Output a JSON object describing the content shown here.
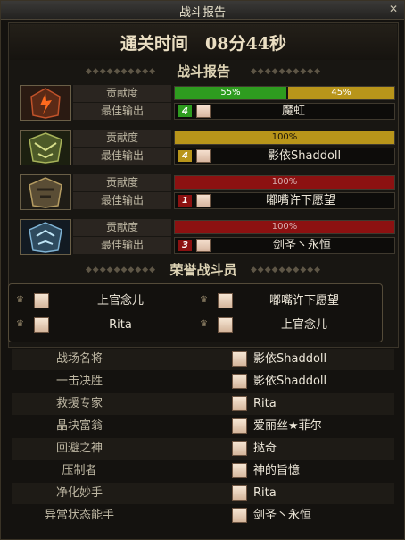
{
  "window": {
    "title": "战斗报告"
  },
  "clear_time": "通关时间　08分44秒",
  "report_heading": "战斗报告",
  "honor_heading": "荣誉战斗员",
  "labels": {
    "contribution": "贡献度",
    "best_output": "最佳输出"
  },
  "colors": {
    "green": "#2e9c1f",
    "gold": "#b8951a",
    "red": "#8c1111"
  },
  "teams": [
    {
      "icon": "fire-helmet-icon",
      "segments": [
        {
          "text": "55%",
          "value": 55,
          "color": "green"
        },
        {
          "text": "45%",
          "value": 45,
          "color": "gold"
        }
      ],
      "best_rank": "4",
      "best_rank_color": "green",
      "best_name": "魔虹"
    },
    {
      "icon": "forest-helmet-icon",
      "segments": [
        {
          "text": "100%",
          "value": 100,
          "color": "gold"
        }
      ],
      "best_rank": "4",
      "best_rank_color": "gold",
      "best_name": "影依Shaddoll"
    },
    {
      "icon": "stone-helmet-icon",
      "segments": [
        {
          "text": "100%",
          "value": 100,
          "color": "red"
        }
      ],
      "best_rank": "1",
      "best_rank_color": "red",
      "best_name": "嘟嘴许下愿望"
    },
    {
      "icon": "ice-helmet-icon",
      "segments": [
        {
          "text": "100%",
          "value": 100,
          "color": "red"
        }
      ],
      "best_rank": "3",
      "best_rank_color": "red",
      "best_name": "剑圣丶永恒"
    }
  ],
  "honor": [
    {
      "name": "上官念儿"
    },
    {
      "name": "嘟嘴许下愿望"
    },
    {
      "name": "Rita"
    },
    {
      "name": "上官念儿"
    }
  ],
  "awards": [
    {
      "title": "战场名将",
      "player": "影依Shaddoll"
    },
    {
      "title": "一击决胜",
      "player": "影依Shaddoll"
    },
    {
      "title": "救援专家",
      "player": "Rita"
    },
    {
      "title": "晶块富翁",
      "player": "爱丽丝★菲尔"
    },
    {
      "title": "回避之神",
      "player": "挞奇"
    },
    {
      "title": "压制者",
      "player": "神的旨憶"
    },
    {
      "title": "净化妙手",
      "player": "Rita"
    },
    {
      "title": "异常状态能手",
      "player": "剑圣丶永恒"
    }
  ]
}
